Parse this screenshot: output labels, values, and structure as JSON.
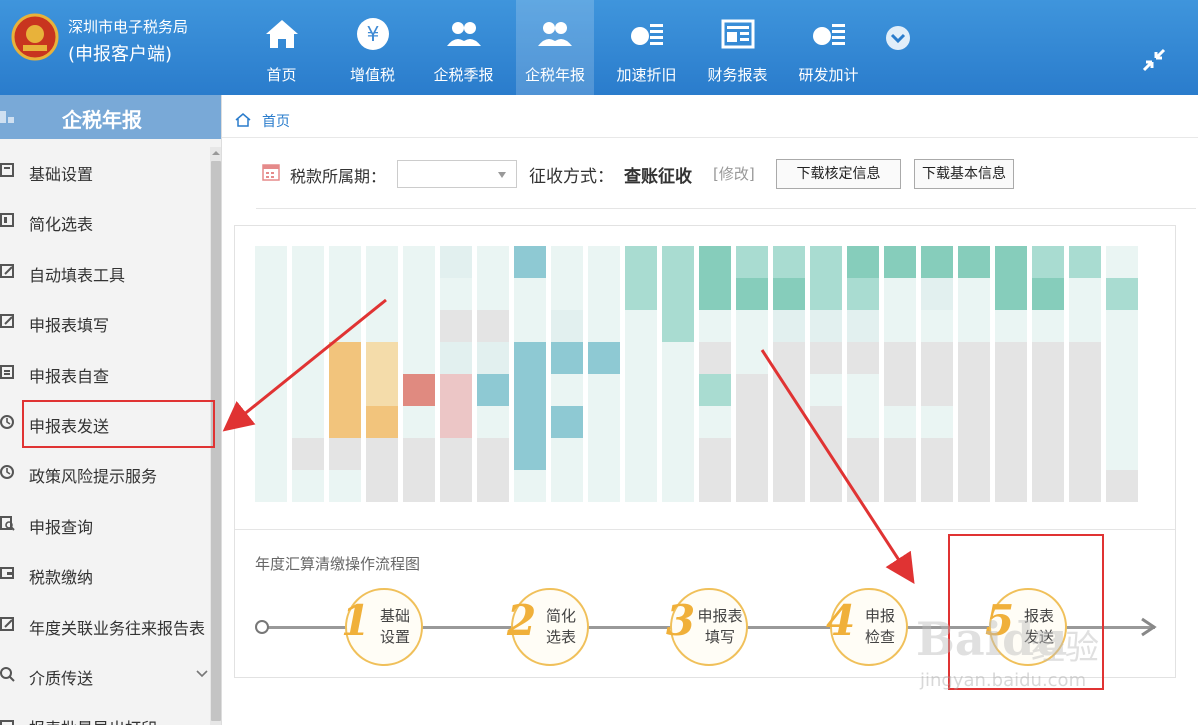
{
  "header": {
    "org_name": "深圳市电子税务局",
    "app_name": "(申报客户端)",
    "nav": [
      {
        "label": "首页",
        "icon": "home-icon"
      },
      {
        "label": "增值税",
        "icon": "yuan-coin-icon"
      },
      {
        "label": "企税季报",
        "icon": "users-icon"
      },
      {
        "label": "企税年报",
        "icon": "users-icon",
        "active": true
      },
      {
        "label": "加速折旧",
        "icon": "money-list-icon"
      },
      {
        "label": "财务报表",
        "icon": "report-icon"
      },
      {
        "label": "研发加计",
        "icon": "money-list-icon"
      }
    ]
  },
  "sidebar": {
    "title": "企税年报",
    "items": [
      {
        "label": "基础设置",
        "icon": "settings-icon"
      },
      {
        "label": "简化选表",
        "icon": "table-icon"
      },
      {
        "label": "自动填表工具",
        "icon": "edit-icon"
      },
      {
        "label": "申报表填写",
        "icon": "edit-icon"
      },
      {
        "label": "申报表自查",
        "icon": "checklist-icon"
      },
      {
        "label": "申报表发送",
        "icon": "send-icon",
        "highlighted": true
      },
      {
        "label": "政策风险提示服务",
        "icon": "clock-icon"
      },
      {
        "label": "申报查询",
        "icon": "search-doc-icon"
      },
      {
        "label": "税款缴纳",
        "icon": "wallet-icon"
      },
      {
        "label": "年度关联业务往来报告表",
        "icon": "edit-icon"
      },
      {
        "label": "介质传送",
        "icon": "search-icon",
        "expandable": true
      },
      {
        "label": "报表批量导出打印",
        "icon": "print-icon"
      }
    ]
  },
  "breadcrumb": {
    "home": "首页"
  },
  "toolbar": {
    "period_label": "税款所属期：",
    "period_value": "",
    "method_label": "征收方式：",
    "method_value": "查账征收",
    "modify_label": "[修改]",
    "download_check": "下载核定信息",
    "download_basic": "下载基本信息"
  },
  "flow": {
    "title": "年度汇算清缴操作流程图",
    "steps": [
      {
        "num": "1",
        "line1": "基础",
        "line2": "设置"
      },
      {
        "num": "2",
        "line1": "简化",
        "line2": "选表"
      },
      {
        "num": "3",
        "line1": "申报表",
        "line2": "填写"
      },
      {
        "num": "4",
        "line1": "申报",
        "line2": "检查"
      },
      {
        "num": "5",
        "line1": "报表",
        "line2": "发送"
      }
    ]
  },
  "watermark": {
    "brand": "Baidu",
    "brand_cn": "经验",
    "url": "jingyan.baidu.com"
  },
  "colors": {
    "header_bg": "#2a7ccc",
    "sidebar_header": "#79a9d7",
    "highlight_red": "#e03333",
    "step_gold": "#f0b03a"
  }
}
